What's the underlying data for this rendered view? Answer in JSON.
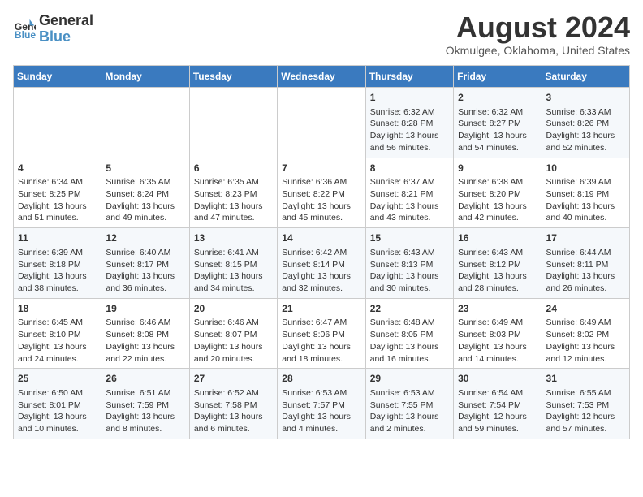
{
  "header": {
    "logo_line1": "General",
    "logo_line2": "Blue",
    "month_year": "August 2024",
    "location": "Okmulgee, Oklahoma, United States"
  },
  "weekdays": [
    "Sunday",
    "Monday",
    "Tuesday",
    "Wednesday",
    "Thursday",
    "Friday",
    "Saturday"
  ],
  "weeks": [
    [
      {
        "day": "",
        "info": ""
      },
      {
        "day": "",
        "info": ""
      },
      {
        "day": "",
        "info": ""
      },
      {
        "day": "",
        "info": ""
      },
      {
        "day": "1",
        "info": "Sunrise: 6:32 AM\nSunset: 8:28 PM\nDaylight: 13 hours and 56 minutes."
      },
      {
        "day": "2",
        "info": "Sunrise: 6:32 AM\nSunset: 8:27 PM\nDaylight: 13 hours and 54 minutes."
      },
      {
        "day": "3",
        "info": "Sunrise: 6:33 AM\nSunset: 8:26 PM\nDaylight: 13 hours and 52 minutes."
      }
    ],
    [
      {
        "day": "4",
        "info": "Sunrise: 6:34 AM\nSunset: 8:25 PM\nDaylight: 13 hours and 51 minutes."
      },
      {
        "day": "5",
        "info": "Sunrise: 6:35 AM\nSunset: 8:24 PM\nDaylight: 13 hours and 49 minutes."
      },
      {
        "day": "6",
        "info": "Sunrise: 6:35 AM\nSunset: 8:23 PM\nDaylight: 13 hours and 47 minutes."
      },
      {
        "day": "7",
        "info": "Sunrise: 6:36 AM\nSunset: 8:22 PM\nDaylight: 13 hours and 45 minutes."
      },
      {
        "day": "8",
        "info": "Sunrise: 6:37 AM\nSunset: 8:21 PM\nDaylight: 13 hours and 43 minutes."
      },
      {
        "day": "9",
        "info": "Sunrise: 6:38 AM\nSunset: 8:20 PM\nDaylight: 13 hours and 42 minutes."
      },
      {
        "day": "10",
        "info": "Sunrise: 6:39 AM\nSunset: 8:19 PM\nDaylight: 13 hours and 40 minutes."
      }
    ],
    [
      {
        "day": "11",
        "info": "Sunrise: 6:39 AM\nSunset: 8:18 PM\nDaylight: 13 hours and 38 minutes."
      },
      {
        "day": "12",
        "info": "Sunrise: 6:40 AM\nSunset: 8:17 PM\nDaylight: 13 hours and 36 minutes."
      },
      {
        "day": "13",
        "info": "Sunrise: 6:41 AM\nSunset: 8:15 PM\nDaylight: 13 hours and 34 minutes."
      },
      {
        "day": "14",
        "info": "Sunrise: 6:42 AM\nSunset: 8:14 PM\nDaylight: 13 hours and 32 minutes."
      },
      {
        "day": "15",
        "info": "Sunrise: 6:43 AM\nSunset: 8:13 PM\nDaylight: 13 hours and 30 minutes."
      },
      {
        "day": "16",
        "info": "Sunrise: 6:43 AM\nSunset: 8:12 PM\nDaylight: 13 hours and 28 minutes."
      },
      {
        "day": "17",
        "info": "Sunrise: 6:44 AM\nSunset: 8:11 PM\nDaylight: 13 hours and 26 minutes."
      }
    ],
    [
      {
        "day": "18",
        "info": "Sunrise: 6:45 AM\nSunset: 8:10 PM\nDaylight: 13 hours and 24 minutes."
      },
      {
        "day": "19",
        "info": "Sunrise: 6:46 AM\nSunset: 8:08 PM\nDaylight: 13 hours and 22 minutes."
      },
      {
        "day": "20",
        "info": "Sunrise: 6:46 AM\nSunset: 8:07 PM\nDaylight: 13 hours and 20 minutes."
      },
      {
        "day": "21",
        "info": "Sunrise: 6:47 AM\nSunset: 8:06 PM\nDaylight: 13 hours and 18 minutes."
      },
      {
        "day": "22",
        "info": "Sunrise: 6:48 AM\nSunset: 8:05 PM\nDaylight: 13 hours and 16 minutes."
      },
      {
        "day": "23",
        "info": "Sunrise: 6:49 AM\nSunset: 8:03 PM\nDaylight: 13 hours and 14 minutes."
      },
      {
        "day": "24",
        "info": "Sunrise: 6:49 AM\nSunset: 8:02 PM\nDaylight: 13 hours and 12 minutes."
      }
    ],
    [
      {
        "day": "25",
        "info": "Sunrise: 6:50 AM\nSunset: 8:01 PM\nDaylight: 13 hours and 10 minutes."
      },
      {
        "day": "26",
        "info": "Sunrise: 6:51 AM\nSunset: 7:59 PM\nDaylight: 13 hours and 8 minutes."
      },
      {
        "day": "27",
        "info": "Sunrise: 6:52 AM\nSunset: 7:58 PM\nDaylight: 13 hours and 6 minutes."
      },
      {
        "day": "28",
        "info": "Sunrise: 6:53 AM\nSunset: 7:57 PM\nDaylight: 13 hours and 4 minutes."
      },
      {
        "day": "29",
        "info": "Sunrise: 6:53 AM\nSunset: 7:55 PM\nDaylight: 13 hours and 2 minutes."
      },
      {
        "day": "30",
        "info": "Sunrise: 6:54 AM\nSunset: 7:54 PM\nDaylight: 12 hours and 59 minutes."
      },
      {
        "day": "31",
        "info": "Sunrise: 6:55 AM\nSunset: 7:53 PM\nDaylight: 12 hours and 57 minutes."
      }
    ]
  ]
}
